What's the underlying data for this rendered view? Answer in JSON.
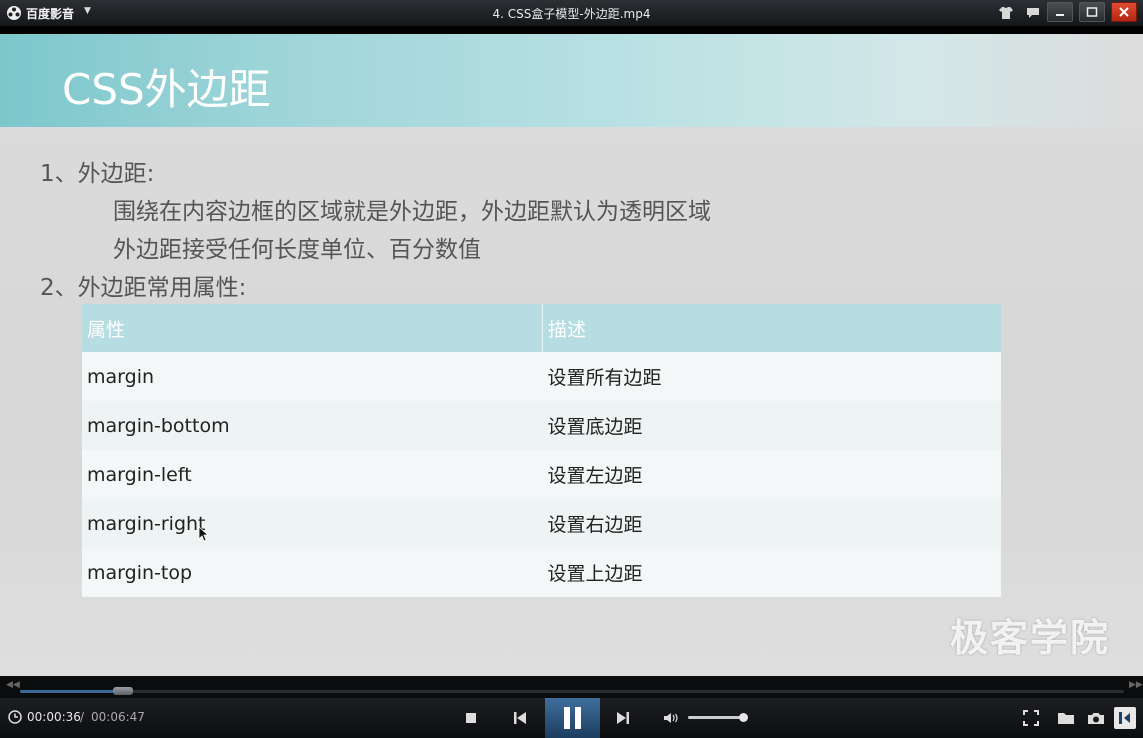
{
  "titlebar": {
    "app_name": "百度影音",
    "menu_arrow": "▼",
    "window_title": "4. CSS盒子模型-外边距.mp4"
  },
  "slide": {
    "title": "CSS外边距",
    "line1": "1、外边距:",
    "line2": "围绕在内容边框的区域就是外边距，外边距默认为透明区域",
    "line3": "外边距接受任何长度单位、百分数值",
    "line4": "2、外边距常用属性:",
    "table": {
      "headers": [
        "属性",
        "描述"
      ],
      "rows": [
        [
          "margin",
          "设置所有边距"
        ],
        [
          "margin-bottom",
          "设置底边距"
        ],
        [
          "margin-left",
          "设置左边距"
        ],
        [
          "margin-right",
          "设置右边距"
        ],
        [
          "margin-top",
          "设置上边距"
        ]
      ]
    },
    "watermark": "极客学院"
  },
  "player": {
    "current_time": "00:00:36",
    "separator": "/",
    "total_time": "00:06:47",
    "progress_fraction": 0.089,
    "volume_fraction": 1.0
  },
  "colors": {
    "header_teal": "#7cc7cc",
    "table_header": "#b5dde2",
    "pause_button": "#3f6f9c",
    "close_button": "#e24b35"
  }
}
